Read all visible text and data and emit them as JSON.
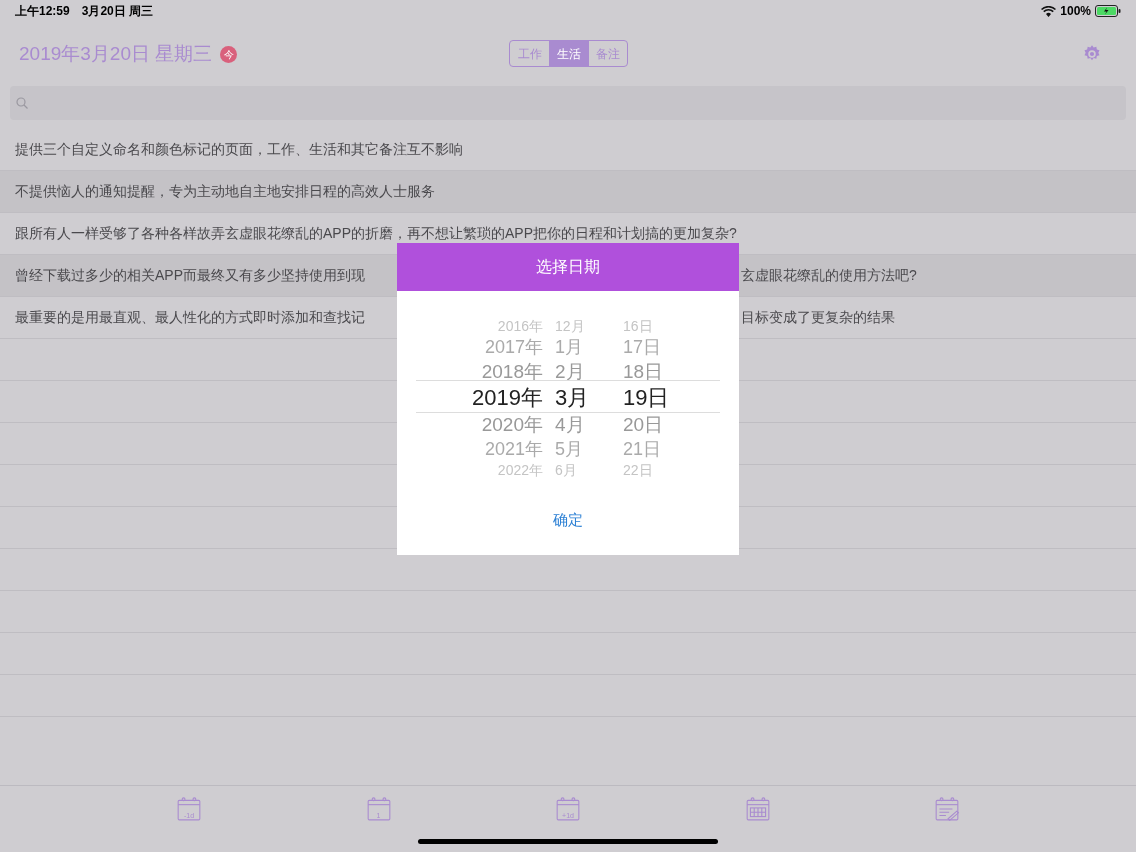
{
  "status_bar": {
    "time": "上午12:59",
    "date": "3月20日 周三",
    "battery": "100%"
  },
  "header": {
    "title": "2019年3月20日 星期三",
    "today_badge": "今",
    "tabs": [
      {
        "label": "工作",
        "selected": false
      },
      {
        "label": "生活",
        "selected": true
      },
      {
        "label": "备注",
        "selected": false
      }
    ]
  },
  "notes": [
    {
      "text": "提供三个自定义命名和颜色标记的页面，工作、生活和其它备注互不影响"
    },
    {
      "text": "不提供恼人的通知提醒，专为主动地自主地安排日程的高效人士服务"
    },
    {
      "text": "跟所有人一样受够了各种各样故弄玄虚眼花缭乱的APP的折磨，再不想让繁琐的APP把你的日程和计划搞的更加复杂?"
    },
    {
      "text": "曾经下载过多少的相关APP而最终又有多少坚持使用到现",
      "text_right": "玄虚眼花缭乱的使用方法吧?"
    },
    {
      "text": "最重要的是用最直观、最人性化的方式即时添加和查找记",
      "text_right": "目标变成了更复杂的结果"
    }
  ],
  "dialog": {
    "title": "选择日期",
    "columns": [
      {
        "items": [
          {
            "label": "2016年",
            "selected": false
          },
          {
            "label": "2017年",
            "selected": false
          },
          {
            "label": "2018年",
            "selected": false
          },
          {
            "label": "2019年",
            "selected": true
          },
          {
            "label": "2020年",
            "selected": false
          },
          {
            "label": "2021年",
            "selected": false
          },
          {
            "label": "2022年",
            "selected": false
          }
        ]
      },
      {
        "items": [
          {
            "label": "12月",
            "selected": false
          },
          {
            "label": "1月",
            "selected": false
          },
          {
            "label": "2月",
            "selected": false
          },
          {
            "label": "3月",
            "selected": true
          },
          {
            "label": "4月",
            "selected": false
          },
          {
            "label": "5月",
            "selected": false
          },
          {
            "label": "6月",
            "selected": false
          }
        ]
      },
      {
        "items": [
          {
            "label": "16日",
            "selected": false
          },
          {
            "label": "17日",
            "selected": false
          },
          {
            "label": "18日",
            "selected": false
          },
          {
            "label": "19日",
            "selected": true
          },
          {
            "label": "20日",
            "selected": false
          },
          {
            "label": "21日",
            "selected": false
          },
          {
            "label": "22日",
            "selected": false
          }
        ]
      }
    ],
    "confirm": "确定"
  },
  "toolbar": [
    {
      "kind": "calendar",
      "label": "-1d"
    },
    {
      "kind": "calendar",
      "label": "1"
    },
    {
      "kind": "calendar",
      "label": "+1d"
    },
    {
      "kind": "grid"
    },
    {
      "kind": "edit"
    }
  ]
}
